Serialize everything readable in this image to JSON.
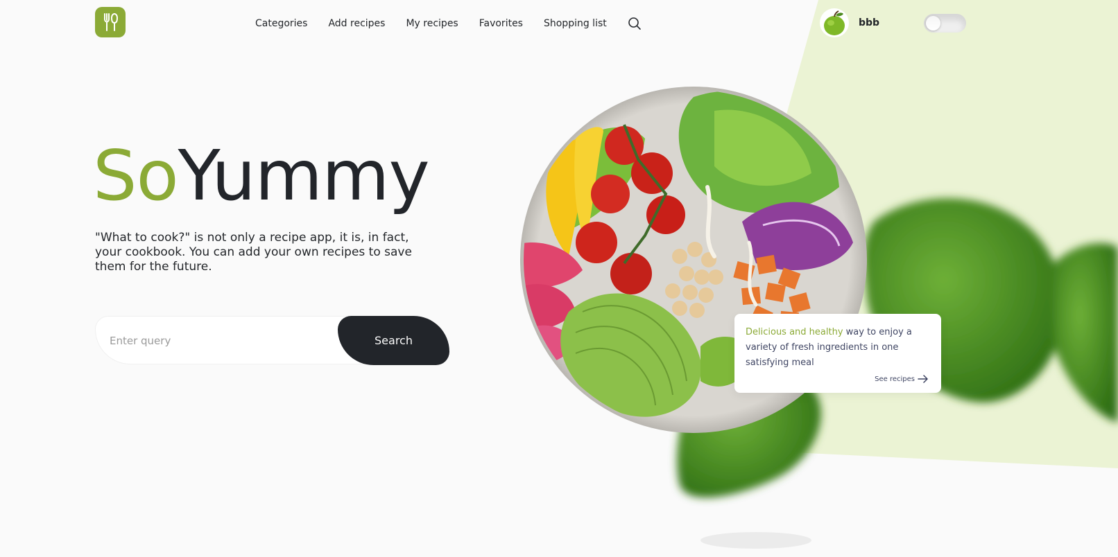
{
  "header": {
    "logo_icon": "fork-knife-icon",
    "nav": [
      {
        "label": "Categories"
      },
      {
        "label": "Add recipes"
      },
      {
        "label": "My recipes"
      },
      {
        "label": "Favorites"
      },
      {
        "label": "Shopping list"
      }
    ],
    "search_icon": "search-icon",
    "user": {
      "name": "bbb",
      "avatar_icon": "apple-icon"
    },
    "theme_toggle_on": false
  },
  "hero": {
    "title_accent": "So",
    "title_rest": "Yummy",
    "description": "\"What to cook?\" is not only a recipe app, it is, in fact, your cookbook. You can add your own recipes to save them for the future.",
    "search": {
      "placeholder": "Enter query",
      "value": "",
      "button_label": "Search"
    }
  },
  "card": {
    "highlight": "Delicious and healthy",
    "text": " way to enjoy a variety of fresh ingredients in one satisfying meal",
    "link_label": "See recipes",
    "link_icon": "arrow-right-icon"
  },
  "colors": {
    "accent": "#8BAA36",
    "dark": "#22252A",
    "background": "#FAFAFA",
    "light_green": "#EBF3D4"
  }
}
